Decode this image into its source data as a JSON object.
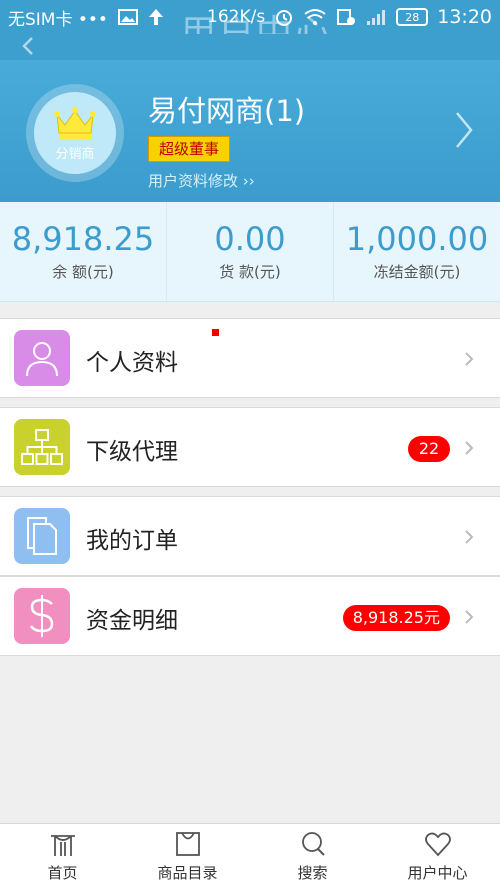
{
  "status_bar": {
    "carrier": "无SIM卡 •••",
    "speed": "162K/s",
    "battery": "28",
    "time": "13:20"
  },
  "header": {
    "title": "用户中心",
    "user_name": "易付网商(1)",
    "avatar_label": "分销商",
    "rank_badge": "超级董事",
    "edit_link": "用户资料修改 ››"
  },
  "balances": [
    {
      "value": "8,918.25",
      "label": "余 额(元)"
    },
    {
      "value": "0.00",
      "label": "货 款(元)"
    },
    {
      "value": "1,000.00",
      "label": "冻结金额(元)"
    }
  ],
  "menu": [
    {
      "label": "个人资料",
      "icon": "person-icon",
      "color": "#d98be8",
      "badge": null
    },
    {
      "label": "下级代理",
      "icon": "org-chart-icon",
      "color": "#c9d12d",
      "badge": "22"
    },
    {
      "label": "我的订单",
      "icon": "documents-icon",
      "color": "#8fbff0",
      "badge": null
    },
    {
      "label": "资金明细",
      "icon": "dollar-icon",
      "color": "#f18fc0",
      "badge": "8,918.25元"
    }
  ],
  "bottom_nav": [
    {
      "label": "首页",
      "icon": "home-icon"
    },
    {
      "label": "商品目录",
      "icon": "catalog-icon"
    },
    {
      "label": "搜索",
      "icon": "search-icon"
    },
    {
      "label": "用户中心",
      "icon": "heart-icon"
    }
  ],
  "colors": {
    "accent": "#3b9ccd",
    "badge": "#ff0000",
    "rank_badge_bg": "#f6d300"
  }
}
